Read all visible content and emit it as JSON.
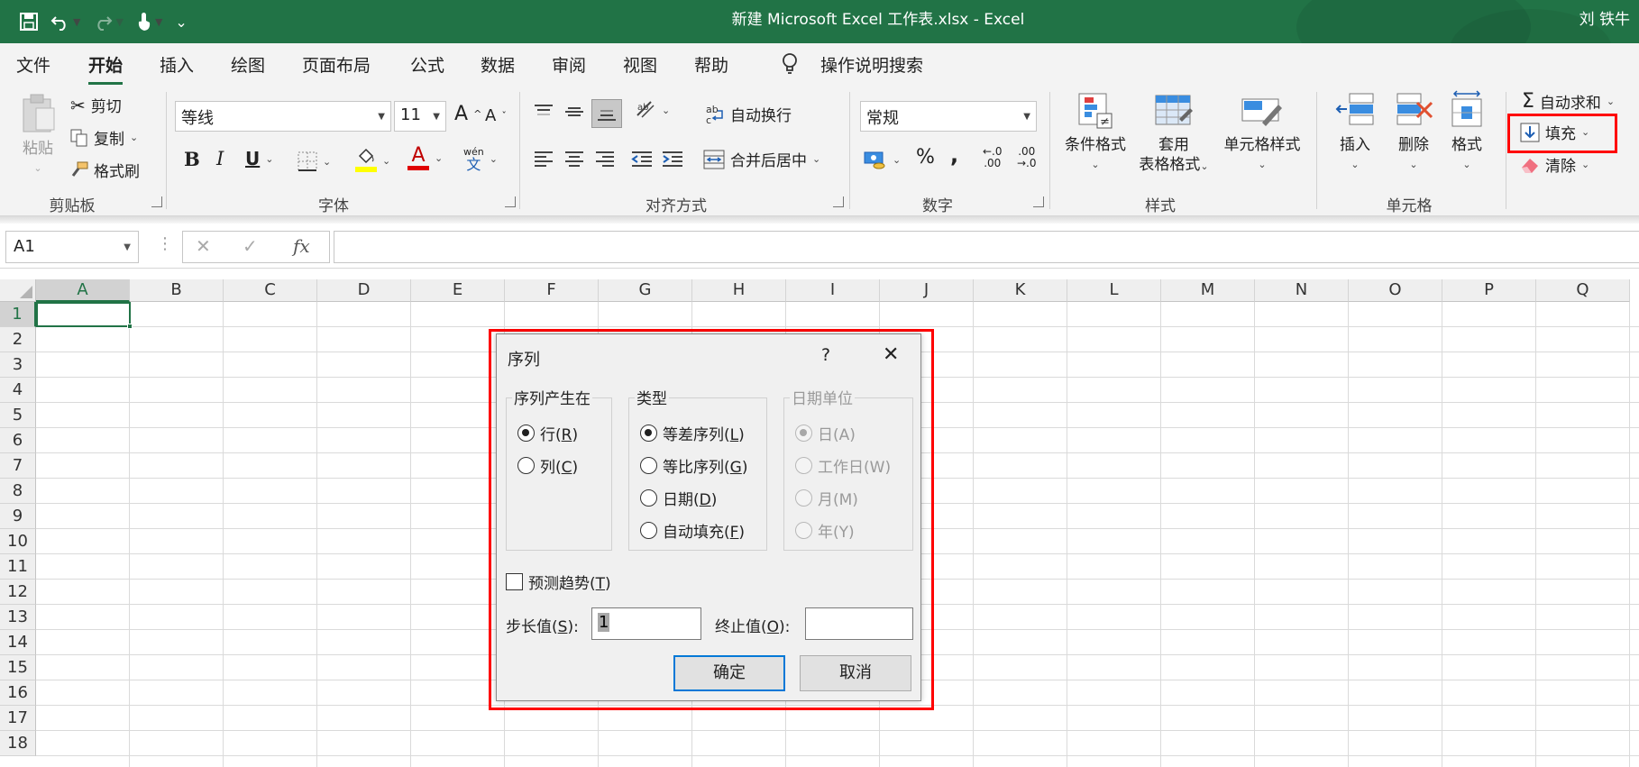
{
  "titlebar": {
    "title": "新建 Microsoft Excel 工作表.xlsx  -  Excel",
    "user": "刘 铁牛",
    "customize_glyph": "⌄"
  },
  "tabs": [
    "文件",
    "开始",
    "插入",
    "绘图",
    "页面布局",
    "公式",
    "数据",
    "审阅",
    "视图",
    "帮助"
  ],
  "active_tab": "开始",
  "tell_me": "操作说明搜索",
  "ribbon": {
    "clipboard": {
      "paste": "粘贴",
      "cut": "剪切",
      "copy": "复制",
      "format_painter": "格式刷",
      "label": "剪贴板"
    },
    "font": {
      "name": "等线",
      "size": "11",
      "label": "字体",
      "grow": "A",
      "shrink": "A",
      "bold": "B",
      "italic": "I",
      "underline": "U",
      "font_color": "A",
      "phonetic": "wén",
      "phonetic_char": "文"
    },
    "alignment": {
      "wrap": "自动换行",
      "merge": "合并后居中",
      "label": "对齐方式"
    },
    "number": {
      "format": "常规",
      "percent": "%",
      "comma": ",",
      "inc_decimal_top": "←.0",
      "inc_decimal_bottom": ".00",
      "dec_decimal_top": ".00",
      "dec_decimal_bottom": "→.0",
      "label": "数字"
    },
    "styles": {
      "conditional": "条件格式",
      "table_line1": "套用",
      "table_line2": "表格格式",
      "cell_styles": "单元格样式",
      "label": "样式"
    },
    "cells": {
      "insert": "插入",
      "delete": "删除",
      "format": "格式",
      "label": "单元格"
    },
    "editing": {
      "autosum": "自动求和",
      "fill": "填充",
      "clear": "清除",
      "sigma": "Σ"
    }
  },
  "formula_bar": {
    "name_box": "A1",
    "cancel": "✕",
    "enter": "✓",
    "fx": "fx",
    "value": ""
  },
  "columns": [
    "A",
    "B",
    "C",
    "D",
    "E",
    "F",
    "G",
    "H",
    "I",
    "J",
    "K",
    "L",
    "M",
    "N",
    "O",
    "P",
    "Q"
  ],
  "rows": [
    "1",
    "2",
    "3",
    "4",
    "5",
    "6",
    "7",
    "8",
    "9",
    "10",
    "11",
    "12",
    "13",
    "14",
    "15",
    "16",
    "17",
    "18"
  ],
  "selected_cell": "A1",
  "dialog": {
    "title": "序列",
    "help": "?",
    "close": "✕",
    "series_in": {
      "legend": "序列产生在",
      "rows_label": "行(",
      "rows_key": "R",
      "cols_label": "列(",
      "cols_key": "C",
      "selected": "rows"
    },
    "type": {
      "legend": "类型",
      "options": [
        {
          "label": "等差序列(",
          "key": "L",
          "selected": true
        },
        {
          "label": "等比序列(",
          "key": "G",
          "selected": false
        },
        {
          "label": "日期(",
          "key": "D",
          "selected": false
        },
        {
          "label": "自动填充(",
          "key": "F",
          "selected": false
        }
      ]
    },
    "date_unit": {
      "legend": "日期单位",
      "options": [
        {
          "label": "日(A)",
          "selected": true
        },
        {
          "label": "工作日(W)",
          "selected": false
        },
        {
          "label": "月(M)",
          "selected": false
        },
        {
          "label": "年(Y)",
          "selected": false
        }
      ]
    },
    "trend": {
      "label": "预测趋势(",
      "key": "T",
      "checked": false
    },
    "step": {
      "label": "步长值(",
      "key": "S",
      "suffix": "):",
      "value": "1"
    },
    "stop": {
      "label": "终止值(",
      "key": "O",
      "suffix": "):",
      "value": ""
    },
    "ok": "确定",
    "cancel": "取消"
  },
  "colors": {
    "excel_green": "#217346",
    "highlight_red": "#ff0000",
    "highlight_yellow": "#ffff00",
    "font_red": "#e00000",
    "dialog_primary": "#0078d7"
  }
}
